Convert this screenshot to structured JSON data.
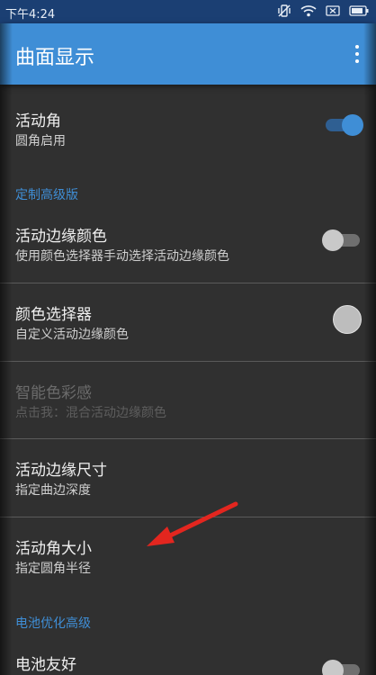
{
  "status_bar": {
    "time": "下午4:24",
    "icons": [
      "vibrate-off-icon",
      "wifi-icon",
      "battery-x-icon",
      "battery-icon"
    ]
  },
  "app_bar": {
    "title": "曲面显示",
    "menu_icon": "more-vert-icon"
  },
  "colors": {
    "accent": "#3f8ed6",
    "background": "#303030",
    "status_bar": "#1b3f73",
    "arrow": "#e3261f"
  },
  "items": [
    {
      "title": "活动角",
      "subtitle": "圆角启用",
      "control": "switch",
      "checked": true,
      "enabled": true
    },
    {
      "title": "活动边缘颜色",
      "subtitle": "使用颜色选择器手动选择活动边缘颜色",
      "control": "switch",
      "checked": false,
      "enabled": true
    },
    {
      "title": "颜色选择器",
      "subtitle": "自定义活动边缘颜色",
      "control": "color",
      "enabled": true
    },
    {
      "title": "智能色彩感",
      "subtitle": "点击我：混合活动边缘颜色",
      "control": "none",
      "enabled": false
    },
    {
      "title": "活动边缘尺寸",
      "subtitle": "指定曲边深度",
      "control": "none",
      "enabled": true
    },
    {
      "title": "活动角大小",
      "subtitle": "指定圆角半径",
      "control": "none",
      "enabled": true
    },
    {
      "title": "电池友好",
      "subtitle": "",
      "control": "switch",
      "checked": false,
      "enabled": true
    }
  ],
  "sections": [
    {
      "label": "定制高级版"
    },
    {
      "label": "电池优化高级"
    }
  ],
  "annotation": {
    "type": "arrow-icon",
    "color": "#e3261f"
  }
}
